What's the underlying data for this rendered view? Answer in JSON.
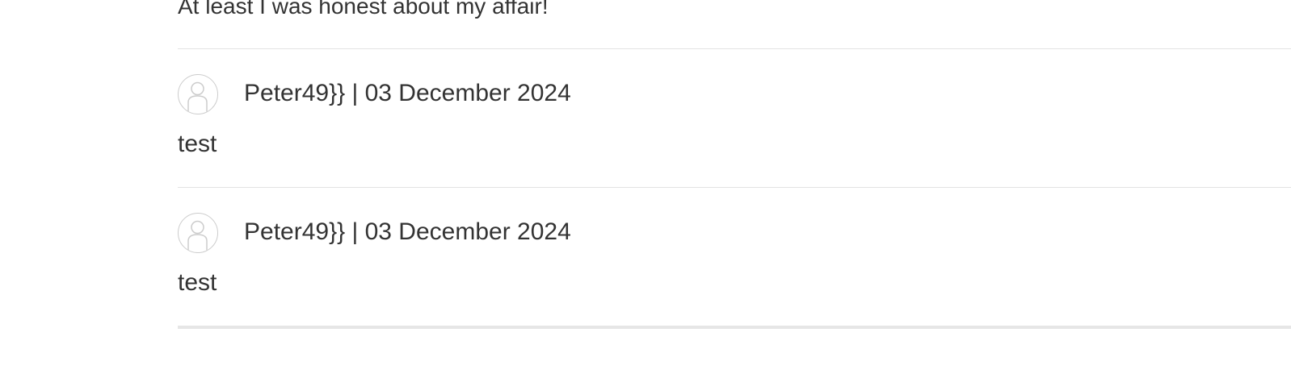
{
  "previous_comment": {
    "text": "At least I was honest about my affair!"
  },
  "comments": [
    {
      "avatar_icon": "user-avatar-icon",
      "author": "Peter49}}",
      "separator": " | ",
      "date": "03 December 2024",
      "body": "test"
    },
    {
      "avatar_icon": "user-avatar-icon",
      "author": "Peter49}}",
      "separator": " | ",
      "date": "03 December 2024",
      "body": "test"
    }
  ],
  "colors": {
    "text": "#333333",
    "divider": "#e3e3e3",
    "avatar_outline": "#cccccc"
  }
}
